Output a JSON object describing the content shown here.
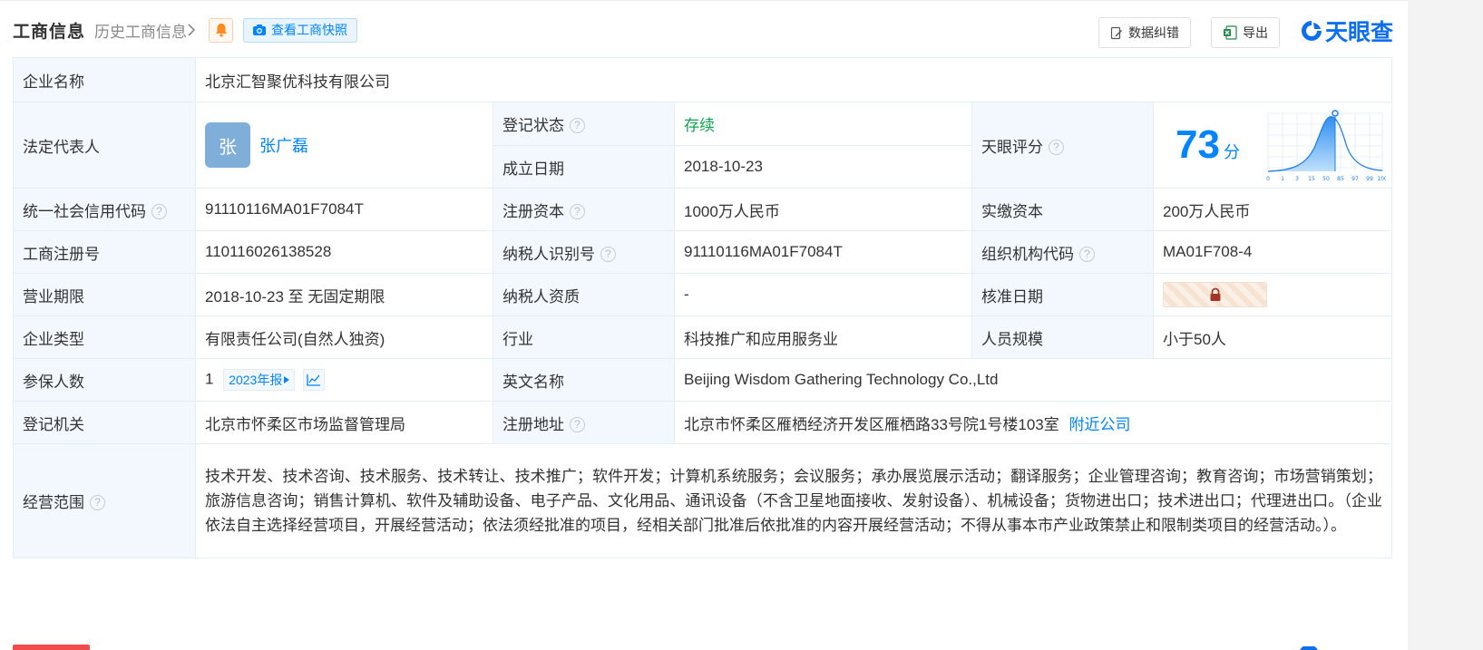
{
  "header": {
    "title": "工商信息",
    "history_label": "历史工商信息",
    "snapshot_label": "查看工商快照",
    "correction_label": "数据纠错",
    "export_label": "导出",
    "logo_text": "天眼查"
  },
  "colors": {
    "accent": "#0084ff",
    "status_green": "#13a34e",
    "label_bg": "#f2f8fd",
    "logo": "#0d6ff0"
  },
  "company": {
    "name_label": "企业名称",
    "name": "北京汇智聚优科技有限公司",
    "legal_rep_label": "法定代表人",
    "legal_rep_avatar": "张",
    "legal_rep_name": "张广磊",
    "reg_status_label": "登记状态",
    "reg_status": "存续",
    "found_date_label": "成立日期",
    "found_date": "2018-10-23",
    "tianyan_score_label": "天眼评分",
    "score": "73",
    "score_unit": "分",
    "score_axis_labels": [
      "0",
      "1",
      "3",
      "15",
      "50",
      "85",
      "97",
      "99",
      "100"
    ],
    "credit_code_label": "统一社会信用代码",
    "credit_code": "91110116MA01F7084T",
    "reg_capital_label": "注册资本",
    "reg_capital": "1000万人民币",
    "paid_capital_label": "实缴资本",
    "paid_capital": "200万人民币",
    "biz_reg_no_label": "工商注册号",
    "biz_reg_no": "110116026138528",
    "taxpayer_id_label": "纳税人识别号",
    "taxpayer_id": "91110116MA01F7084T",
    "org_code_label": "组织机构代码",
    "org_code": "MA01F708-4",
    "term_label": "营业期限",
    "term": "2018-10-23 至 无固定期限",
    "taxpayer_qual_label": "纳税人资质",
    "taxpayer_qual": "-",
    "approval_date_label": "核准日期",
    "type_label": "企业类型",
    "type": "有限责任公司(自然人独资)",
    "industry_label": "行业",
    "industry": "科技推广和应用服务业",
    "staff_size_label": "人员规模",
    "staff_size": "小于50人",
    "insured_label": "参保人数",
    "insured_count": "1",
    "insured_report": "2023年报",
    "english_name_label": "英文名称",
    "english_name": "Beijing Wisdom Gathering Technology Co.,Ltd",
    "authority_label": "登记机关",
    "authority": "北京市怀柔区市场监督管理局",
    "address_label": "注册地址",
    "address": "北京市怀柔区雁栖经济开发区雁栖路33号院1号楼103室",
    "nearby_label": "附近公司",
    "scope_label": "经营范围",
    "scope": "技术开发、技术咨询、技术服务、技术转让、技术推广；软件开发；计算机系统服务；会议服务；承办展览展示活动；翻译服务；企业管理咨询；教育咨询；市场营销策划；旅游信息咨询；销售计算机、软件及辅助设备、电子产品、文化用品、通讯设备（不含卫星地面接收、发射设备）、机械设备；货物进出口；技术进出口；代理进出口。（企业依法自主选择经营项目，开展经营活动；依法须经批准的项目，经相关部门批准后依批准的内容开展经营活动；不得从事本市产业政策禁止和限制类项目的经营活动。）。"
  }
}
